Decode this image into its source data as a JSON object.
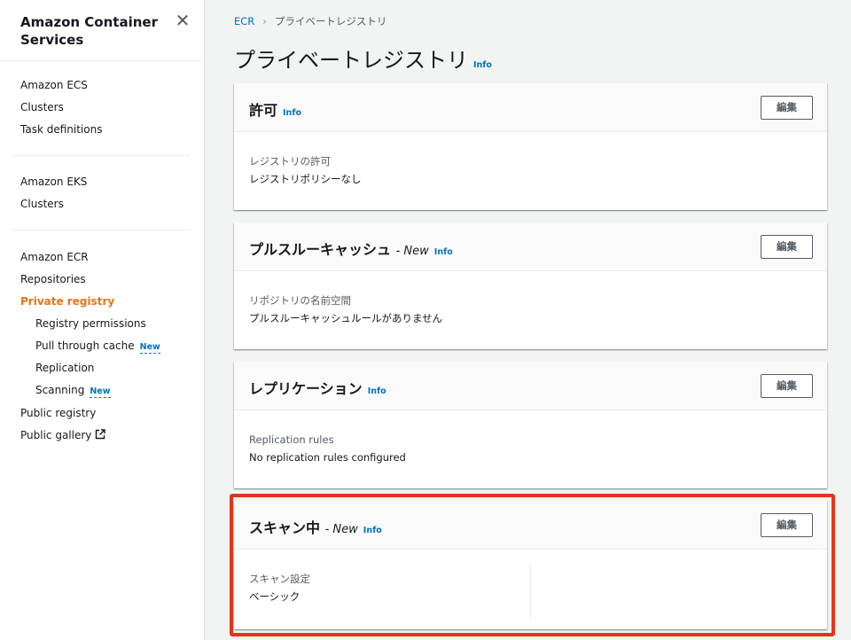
{
  "sidebar": {
    "title": "Amazon Container Services",
    "sections": [
      {
        "heading": "Amazon ECS",
        "items": [
          "Clusters",
          "Task definitions"
        ]
      },
      {
        "heading": "Amazon EKS",
        "items": [
          "Clusters"
        ]
      },
      {
        "heading": "Amazon ECR"
      }
    ],
    "ecr": {
      "repositories": "Repositories",
      "private_registry": "Private registry",
      "registry_permissions": "Registry permissions",
      "pull_through_cache": "Pull through cache",
      "replication": "Replication",
      "scanning": "Scanning",
      "public_registry": "Public registry",
      "public_gallery": "Public gallery",
      "new_badge": "New"
    }
  },
  "breadcrumb": {
    "root": "ECR",
    "current": "プライベートレジストリ"
  },
  "page": {
    "title": "プライベートレジストリ",
    "info": "Info"
  },
  "panels": {
    "permissions": {
      "title": "許可",
      "info": "Info",
      "edit": "編集",
      "label": "レジストリの許可",
      "value": "レジストリポリシーなし"
    },
    "pull_through": {
      "title": "プルスルーキャッシュ",
      "new": "- New",
      "info": "Info",
      "edit": "編集",
      "label": "リポジトリの名前空間",
      "value": "プルスルーキャッシュルールがありません"
    },
    "replication": {
      "title": "レプリケーション",
      "info": "Info",
      "edit": "編集",
      "label": "Replication rules",
      "value": "No replication rules configured"
    },
    "scanning": {
      "title": "スキャン中",
      "new": "- New",
      "info": "Info",
      "edit": "編集",
      "label": "スキャン設定",
      "value": "ベーシック"
    }
  },
  "colors": {
    "accent": "#ec7211",
    "link": "#0073bb",
    "highlight": "#e8331c"
  }
}
